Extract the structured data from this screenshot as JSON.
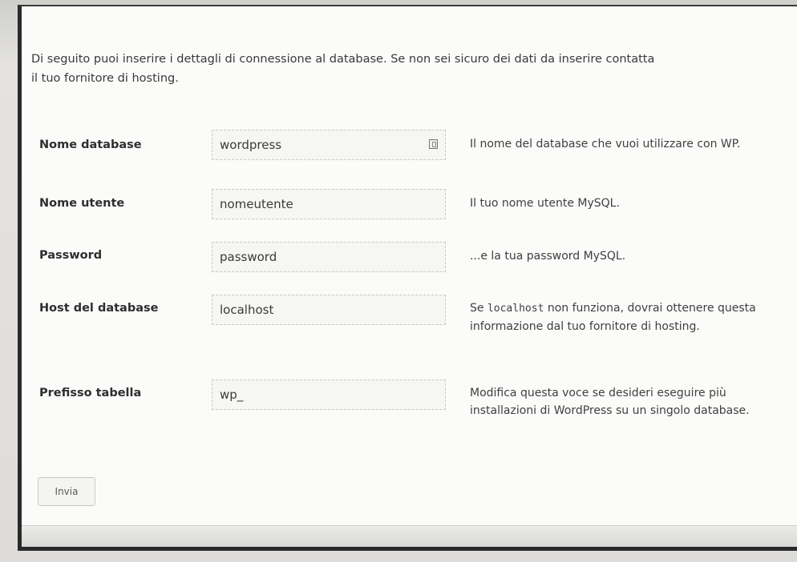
{
  "intro": {
    "line1": "Di seguito puoi inserire i dettagli di connessione al database. Se non sei sicuro dei dati da inserire contatta",
    "line2": "il tuo fornitore di hosting."
  },
  "fields": [
    {
      "label": "Nome database",
      "value": "wordpress",
      "desc": "Il nome del database che vuoi utilizzare con WP."
    },
    {
      "label": "Nome utente",
      "value": "nomeutente",
      "desc": "Il tuo nome utente MySQL."
    },
    {
      "label": "Password",
      "value": "password",
      "desc": "...e la tua password MySQL."
    },
    {
      "label": "Host del database",
      "value": "localhost",
      "desc_pre": "Se ",
      "desc_code": "localhost",
      "desc_post": " non funziona, dovrai ottenere questa informazione dal tuo fornitore di hosting."
    },
    {
      "label": "Prefisso tabella",
      "value": "wp_",
      "desc": "Modifica questa voce se desideri eseguire più installazioni di WordPress su un singolo database."
    }
  ],
  "submit_label": "Invia",
  "icons": {
    "field_icon": "lock-icon"
  }
}
